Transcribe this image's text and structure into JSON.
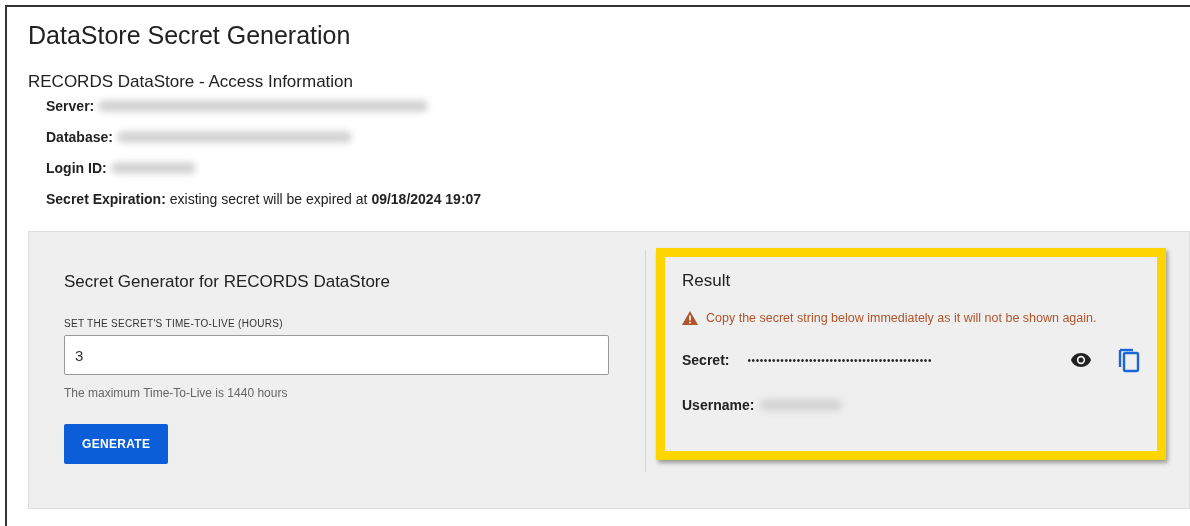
{
  "page": {
    "title": "DataStore Secret Generation"
  },
  "access_info": {
    "title": "RECORDS DataStore - Access Information",
    "fields": [
      {
        "label": "Server:",
        "redacted": true
      },
      {
        "label": "Database:",
        "redacted": true
      },
      {
        "label": "Login ID:",
        "redacted": true
      },
      {
        "label": "Secret Expiration:",
        "value": "existing secret will be expired at **09/18/2024 19:07**",
        "redacted": false
      }
    ]
  },
  "generator": {
    "title": "Secret Generator for RECORDS DataStore",
    "field_label": "SET THE SECRET'S TIME-TO-LIVE (HOURS)",
    "value": "3",
    "hint": "The maximum Time-To-Live is 1440 hours",
    "button": "GENERATE"
  },
  "result": {
    "title": "Result",
    "highlighted": true,
    "warning": "Copy the secret string below immediately as it will not be shown again.",
    "secret_label": "Secret:",
    "secret_value": "•••••••••••••••••••••••••••••••••••••••••••••",
    "username_label": "Username:",
    "username_redacted": true
  }
}
